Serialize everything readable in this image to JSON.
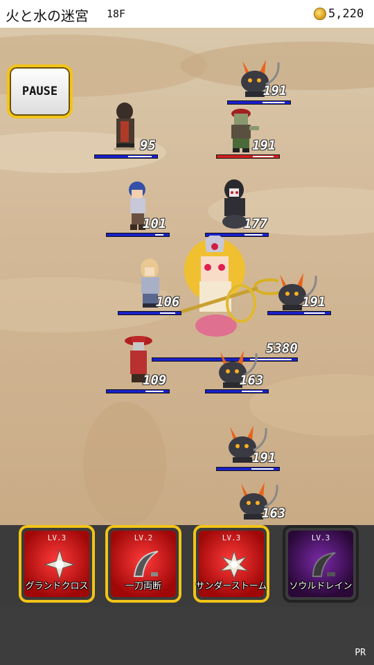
{
  "header": {
    "dungeon_name": "火と水の迷宮",
    "floor": "18F",
    "coins": "5,220"
  },
  "pause_label": "PAUSE",
  "allies": [
    {
      "hp": "95",
      "hp_fraction": 0.55
    },
    {
      "hp": "101",
      "hp_fraction": 0.85
    },
    {
      "hp": "106",
      "hp_fraction": 0.75
    },
    {
      "hp": "109",
      "hp_fraction": 0.7
    }
  ],
  "enemies": [
    {
      "type": "flame-beast",
      "hp": "191",
      "hp_fraction": 0.6
    },
    {
      "type": "pirate-zombie",
      "hp": "191",
      "hp_fraction": 0.55,
      "status": "red"
    },
    {
      "type": "dark-priestess",
      "hp": "177",
      "hp_fraction": 0.7
    },
    {
      "type": "flame-beast",
      "hp": "191",
      "hp_fraction": 0.55
    },
    {
      "type": "flame-beast",
      "hp": "163",
      "hp_fraction": 0.55
    },
    {
      "type": "flame-beast",
      "hp": "191",
      "hp_fraction": 0.6
    },
    {
      "type": "flame-beast",
      "hp": "163",
      "hp_fraction": 0.55
    }
  ],
  "boss": {
    "type": "golden-haired-goddess",
    "hp": "5380",
    "hp_fraction": 0.95
  },
  "skills": [
    {
      "level": "LV.3",
      "name": "グランドクロス",
      "ready": true,
      "icon": "cross-burst-icon"
    },
    {
      "level": "LV.2",
      "name": "一刀両断",
      "ready": true,
      "icon": "blade-slash-icon"
    },
    {
      "level": "LV.3",
      "name": "サンダーストーム",
      "ready": true,
      "icon": "thunder-burst-icon"
    },
    {
      "level": "LV.3",
      "name": "ソウルドレイン",
      "ready": false,
      "icon": "soul-scythe-icon"
    }
  ],
  "ad_label": "PR",
  "colors": {
    "hp_bar": "#1a20c8",
    "hp_bar_low": "#d02020",
    "skill_frame": "#f2c417"
  }
}
